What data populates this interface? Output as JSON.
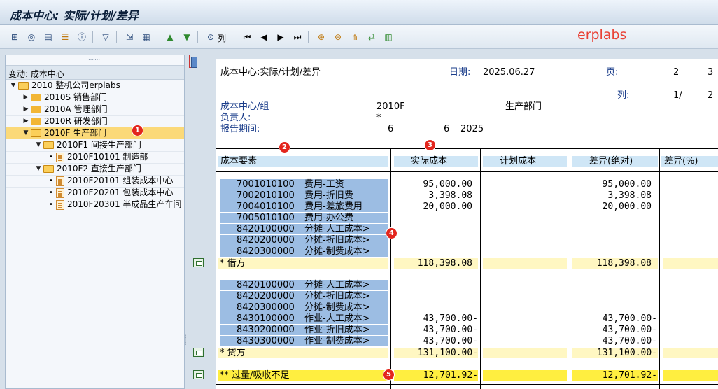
{
  "window": {
    "title": "成本中心: 实际/计划/差异"
  },
  "toolbar": {
    "icons": [
      "hierarchy-icon",
      "overview-icon",
      "print-preview-icon",
      "layout-icon",
      "info-icon",
      "filter-icon",
      "drilldown-icon",
      "report-icon",
      "sort-ascending-icon",
      "sort-descending-icon",
      "find-icon",
      "first-page-icon",
      "previous-page-icon",
      "next-page-icon",
      "last-page-icon",
      "expand-icon",
      "collapse-icon",
      "structure-icon",
      "export-icon",
      "graphic-icon"
    ],
    "columns_label": "列"
  },
  "brand": {
    "text": "erplabs",
    "color": "#e94135"
  },
  "tree": {
    "header": "变动:  成本中心",
    "nodes": [
      {
        "label": "2010 整机公司erplabs",
        "type": "folder-open",
        "level": 0
      },
      {
        "label": "2010S 销售部门",
        "type": "folder",
        "level": 1
      },
      {
        "label": "2010A 管理部门",
        "type": "folder",
        "level": 1
      },
      {
        "label": "2010R 研发部门",
        "type": "folder",
        "level": 1
      },
      {
        "label": "2010F 生产部门",
        "type": "folder-open",
        "level": 1,
        "selected": true
      },
      {
        "label": "2010F1 间接生产部门",
        "type": "folder-open",
        "level": 2
      },
      {
        "label": "2010F10101 制造部",
        "type": "leaf",
        "level": 3
      },
      {
        "label": "2010F2 直接生产部门",
        "type": "folder-open",
        "level": 2
      },
      {
        "label": "2010F20101 组装成本中心",
        "type": "leaf",
        "level": 3
      },
      {
        "label": "2010F20201 包装成本中心",
        "type": "leaf",
        "level": 3
      },
      {
        "label": "2010F20301 半成品生产车间",
        "type": "leaf",
        "level": 3
      }
    ]
  },
  "badges": [
    "1",
    "2",
    "3",
    "4",
    "5"
  ],
  "report": {
    "title": "成本中心:实际/计划/差异",
    "date_label": "日期:",
    "date": "2025.06.27",
    "page_label": "页:",
    "page_num": "2",
    "page_total": "3",
    "col_label": "列:",
    "col_num": "1/",
    "col_total": "2",
    "cc_label": "成本中心/组",
    "cc_value": "2010F",
    "cc_name": "生产部门",
    "resp_label": "负责人:",
    "resp_value": "*",
    "period_label": "报告期间:",
    "period_from": "6",
    "period_to": "6",
    "period_year": "2025",
    "columns": [
      "成本要素",
      "实际成本",
      "计划成本",
      "差异(绝对)",
      "差异(%)"
    ],
    "debit_rows": [
      {
        "id": "7001010100",
        "name": "费用-工资",
        "actual": "95,000.00",
        "variance": "95,000.00"
      },
      {
        "id": "7002010100",
        "name": "费用-折旧费",
        "actual": "3,398.08",
        "variance": "3,398.08"
      },
      {
        "id": "7004010100",
        "name": "费用-差旅费用",
        "actual": "20,000.00",
        "variance": "20,000.00"
      },
      {
        "id": "7005010100",
        "name": "费用-办公费",
        "actual": "",
        "variance": ""
      },
      {
        "id": "8420100000",
        "name": "分摊-人工成本>",
        "actual": "",
        "variance": ""
      },
      {
        "id": "8420200000",
        "name": "分摊-折旧成本>",
        "actual": "",
        "variance": ""
      },
      {
        "id": "8420300000",
        "name": "分摊-制费成本>",
        "actual": "",
        "variance": ""
      }
    ],
    "debit_total": {
      "label": "* 借方",
      "actual": "118,398.08",
      "variance": "118,398.08"
    },
    "credit_rows": [
      {
        "id": "8420100000",
        "name": "分摊-人工成本>",
        "actual": "",
        "variance": ""
      },
      {
        "id": "8420200000",
        "name": "分摊-折旧成本>",
        "actual": "",
        "variance": ""
      },
      {
        "id": "8420300000",
        "name": "分摊-制费成本>",
        "actual": "",
        "variance": ""
      },
      {
        "id": "8430100000",
        "name": "作业-人工成本>",
        "actual": "43,700.00-",
        "variance": "43,700.00-"
      },
      {
        "id": "8430200000",
        "name": "作业-折旧成本>",
        "actual": "43,700.00-",
        "variance": "43,700.00-"
      },
      {
        "id": "8430300000",
        "name": "作业-制费成本>",
        "actual": "43,700.00-",
        "variance": "43,700.00-"
      }
    ],
    "credit_total": {
      "label": "* 贷方",
      "actual": "131,100.00-",
      "variance": "131,100.00-"
    },
    "grand_total": {
      "label": "** 过量/吸收不足",
      "actual": "12,701.92-",
      "variance": "12,701.92-"
    }
  }
}
